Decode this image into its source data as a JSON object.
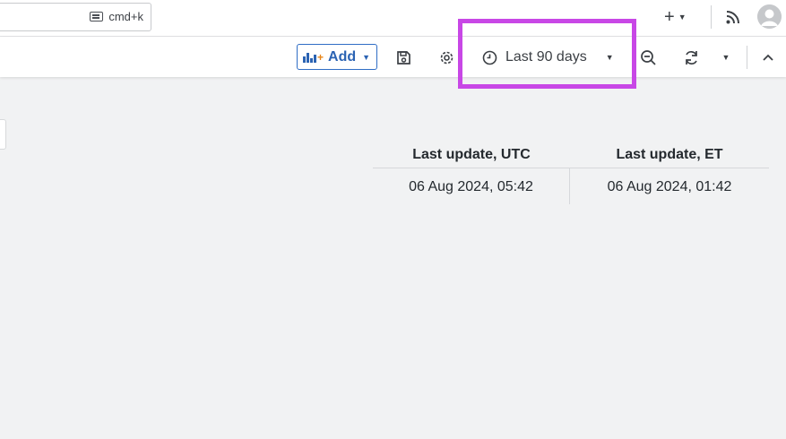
{
  "topbar": {
    "search_shortcut": "cmd+k",
    "plus_label": "+",
    "icons": {
      "keyboard": "keyboard-icon",
      "rss": "rss-icon",
      "avatar": "user-avatar-icon"
    }
  },
  "toolbar": {
    "add_label": "Add",
    "time_range_label": "Last 90 days",
    "icons": [
      "save-icon",
      "gear-icon",
      "clock-icon",
      "zoom-out-icon",
      "refresh-icon",
      "chevron-up-icon"
    ]
  },
  "highlight_color": "#c847e6",
  "accent_color": "#2b63b3",
  "table": {
    "headers": [
      "Last update, UTC",
      "Last update, ET"
    ],
    "rows": [
      [
        "06 Aug 2024, 05:42",
        "06 Aug 2024, 01:42"
      ]
    ]
  }
}
